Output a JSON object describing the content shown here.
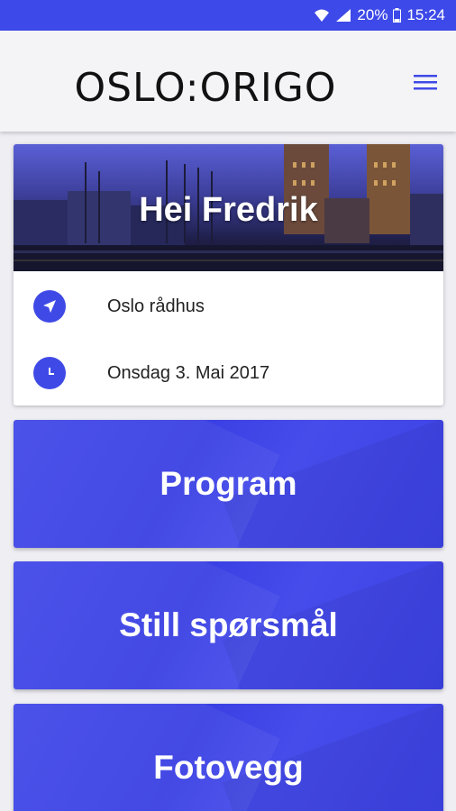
{
  "status_bar": {
    "battery": "20%",
    "time": "15:24",
    "icons": [
      "wifi-icon",
      "signal-icon",
      "battery-icon"
    ]
  },
  "app_bar": {
    "title": "OSLO:ORIGO",
    "menu_icon": "hamburger-menu-icon"
  },
  "event_card": {
    "greeting": "Hei Fredrik",
    "location": "Oslo rådhus",
    "date": "Onsdag 3. Mai 2017",
    "location_icon": "navigation-arrow-icon",
    "date_icon": "clock-icon"
  },
  "tiles": [
    {
      "label": "Program"
    },
    {
      "label": "Still spørsmål"
    },
    {
      "label": "Fotovegg"
    }
  ],
  "colors": {
    "status_bar": "#3d49e8",
    "accent": "#3f4ae6",
    "tile": "#4048e6",
    "app_bar": "#f4f4f7",
    "background": "#eeeef3"
  }
}
